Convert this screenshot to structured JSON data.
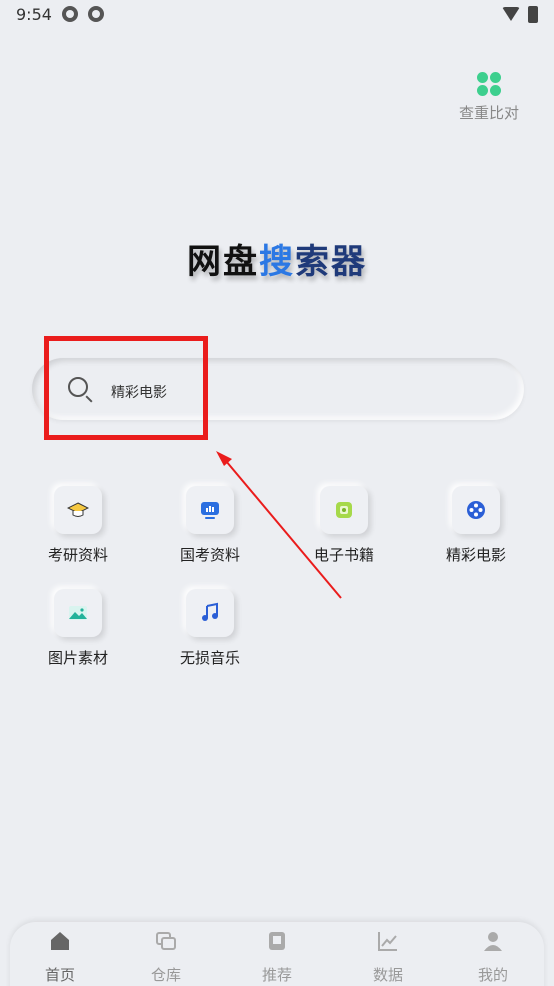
{
  "status_bar": {
    "time": "9:54"
  },
  "compare": {
    "label": "查重比对"
  },
  "title": {
    "part_a": "网盘",
    "part_b": "搜",
    "part_c": "索器"
  },
  "search": {
    "value": "精彩电影"
  },
  "categories": [
    {
      "label": "考研资料",
      "icon": "graduation-cap-icon"
    },
    {
      "label": "国考资料",
      "icon": "presentation-icon"
    },
    {
      "label": "电子书籍",
      "icon": "book-icon"
    },
    {
      "label": "精彩电影",
      "icon": "film-reel-icon"
    },
    {
      "label": "图片素材",
      "icon": "image-icon"
    },
    {
      "label": "无损音乐",
      "icon": "music-note-icon"
    }
  ],
  "nav": [
    {
      "label": "首页",
      "icon": "home-icon"
    },
    {
      "label": "仓库",
      "icon": "warehouse-icon"
    },
    {
      "label": "推荐",
      "icon": "recommend-icon"
    },
    {
      "label": "数据",
      "icon": "chart-icon"
    },
    {
      "label": "我的",
      "icon": "profile-icon"
    }
  ],
  "colors": {
    "background": "#eceef2",
    "title_blue": "#2b78e4",
    "title_navy": "#1f3a7a",
    "highlight_red": "#ea1c1c",
    "clover_green": "#3dcf8e"
  }
}
